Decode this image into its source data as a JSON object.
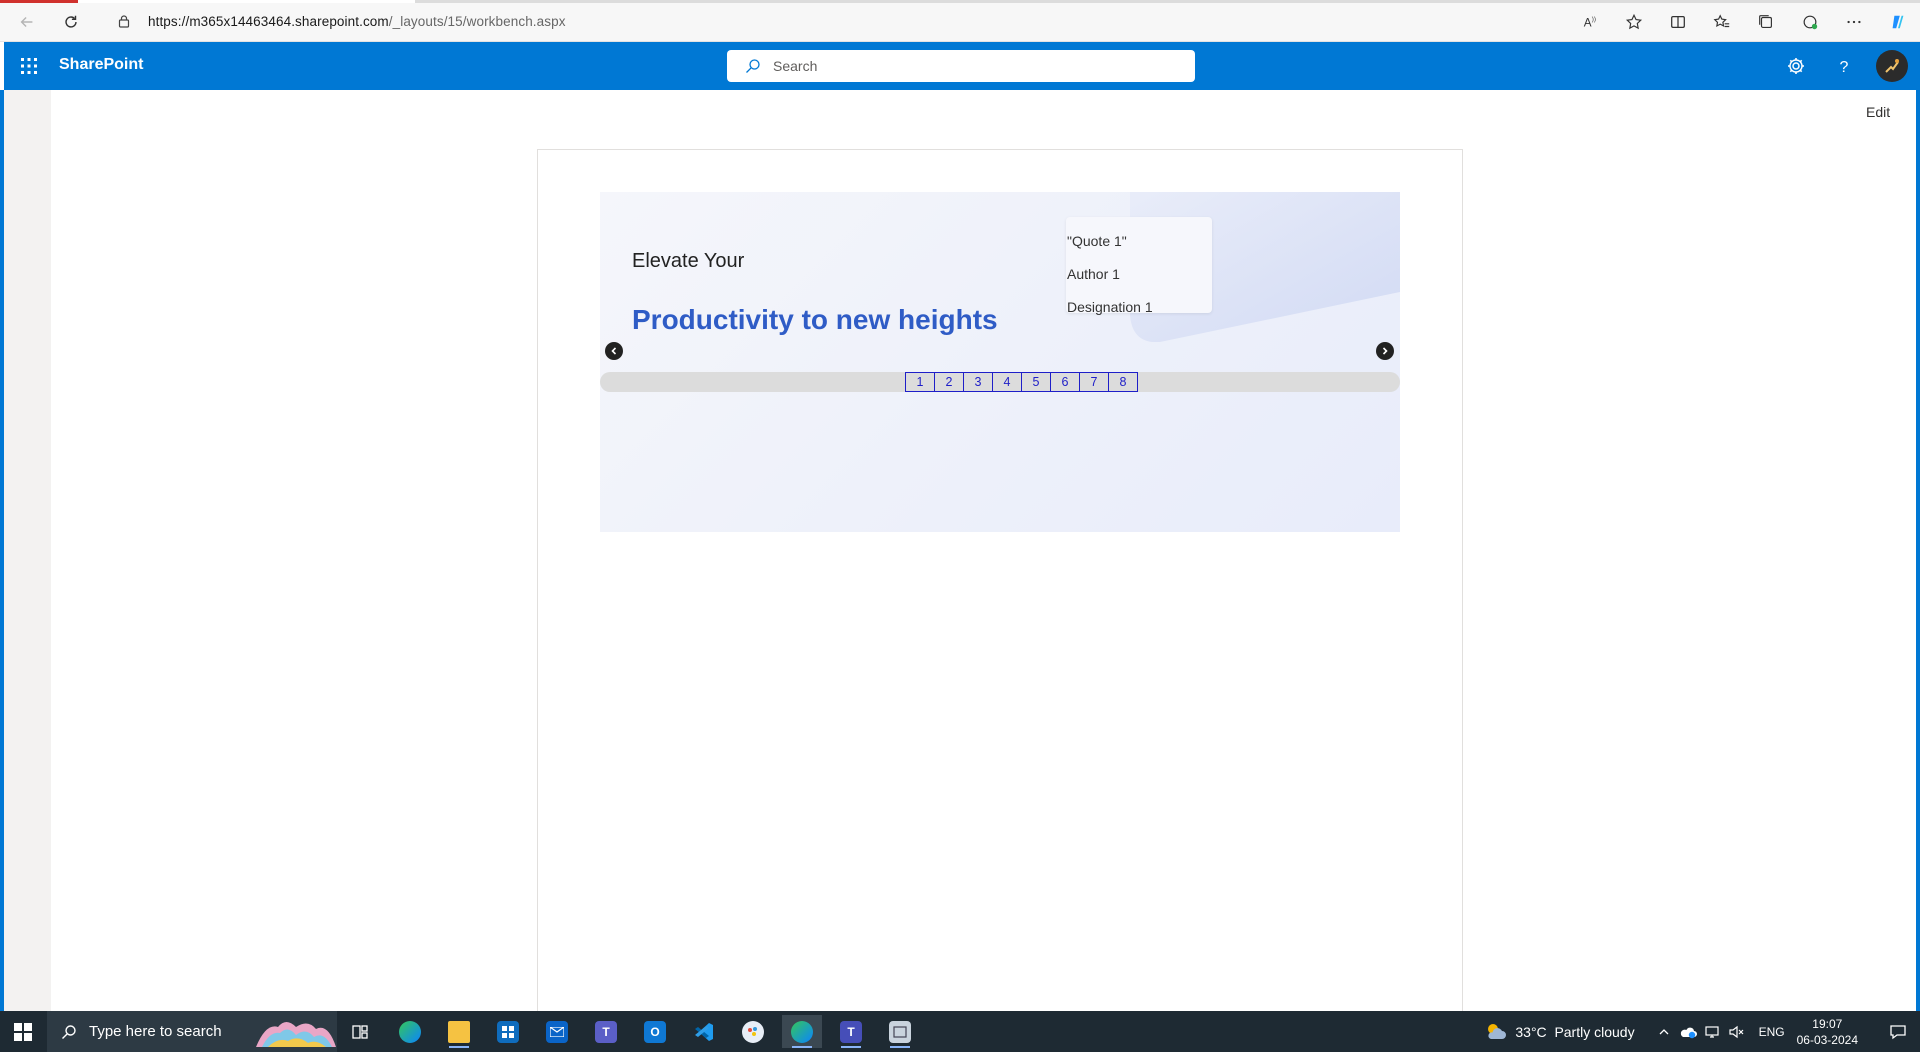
{
  "browser": {
    "url_host": "https://m365x14463464.sharepoint.com",
    "url_path": "/_layouts/15/workbench.aspx"
  },
  "suite": {
    "title": "SharePoint",
    "search_placeholder": "Search",
    "accent_color": "#0078d4"
  },
  "page": {
    "edit_label": "Edit"
  },
  "hero": {
    "line1": "Elevate Your",
    "line2": "Productivity to new heights",
    "quote": "\"Quote 1\"",
    "author": "Author 1",
    "designation": "Designation 1",
    "pages": [
      "1",
      "2",
      "3",
      "4",
      "5",
      "6",
      "7",
      "8"
    ],
    "headline_color": "#2f5cc6",
    "pager_color": "#1e1ec8"
  },
  "taskbar": {
    "search_placeholder": "Type here to search",
    "temperature": "33°C",
    "weather": "Partly cloudy",
    "language": "ENG",
    "time": "19:07",
    "date": "06-03-2024"
  }
}
